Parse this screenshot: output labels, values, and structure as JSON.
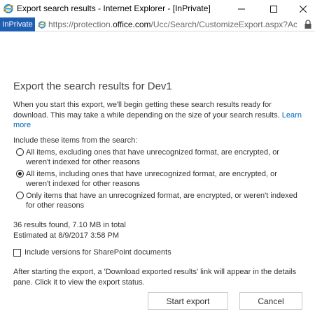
{
  "window": {
    "title": "Export search results - Internet Explorer - [InPrivate]",
    "icon": "ie-icon",
    "controls": [
      "minimize-icon",
      "maximize-icon",
      "close-icon"
    ]
  },
  "address_bar": {
    "inprivate_label": "InPrivate",
    "url_prefix": "https://protection.",
    "url_domain": "office.com",
    "url_suffix": "/Ucc/Search/CustomizeExport.aspx?ActivityCorrelati"
  },
  "page": {
    "title": "Export the search results for Dev1",
    "intro": "When you start this export, we'll begin getting these search results ready for download. This may take a while depending on the size of your search results. ",
    "learn_more": "Learn more",
    "include_label": "Include these items from the search:",
    "options": [
      {
        "label": "All items, excluding ones that have unrecognized format, are encrypted, or weren't indexed for other reasons",
        "selected": false
      },
      {
        "label": "All items, including ones that have unrecognized format, are encrypted, or weren't indexed for other reasons",
        "selected": true
      },
      {
        "label": "Only items that have an unrecognized format, are encrypted, or weren't indexed for other reasons",
        "selected": false
      }
    ],
    "results_found": "36 results found, 7.10 MB in total",
    "estimated": "Estimated at 8/9/2017 3:58 PM",
    "sharepoint_checkbox": {
      "label": "Include versions for SharePoint documents",
      "checked": false
    },
    "footnote": "After starting the export, a 'Download exported results' link will appear in the details pane. Click it to view the export status.",
    "start_button": "Start export",
    "cancel_button": "Cancel"
  },
  "colors": {
    "inprivate_bg": "#1f5fb3",
    "link": "#0066b8",
    "ie_blue": "#1e90e6",
    "ie_gold": "#f5b400"
  }
}
